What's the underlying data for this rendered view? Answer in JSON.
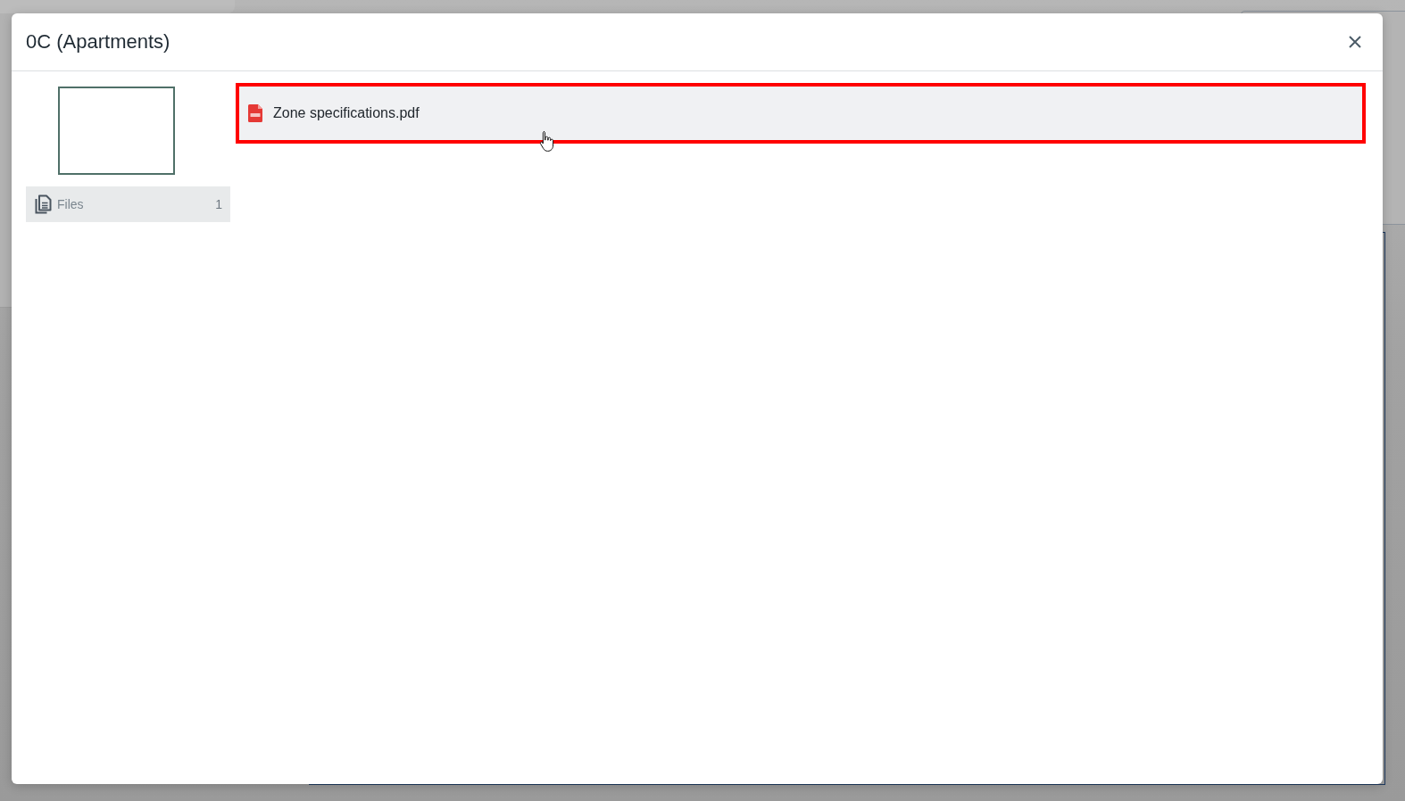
{
  "dialog": {
    "title": "0C (Apartments)"
  },
  "sidebar": {
    "items": [
      {
        "label": "Files",
        "count": "1",
        "selected": true
      }
    ]
  },
  "files": [
    {
      "name": "Zone specifications.pdf",
      "kind": "pdf",
      "highlighted": true
    }
  ]
}
